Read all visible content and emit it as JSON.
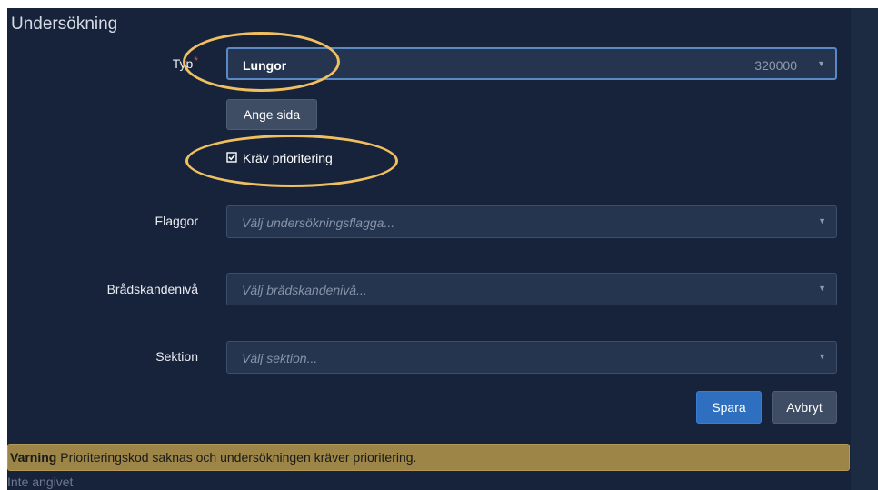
{
  "section_title": "Undersökning",
  "form": {
    "type": {
      "label": "Typ",
      "required_mark": "*",
      "value": "Lungor",
      "code": "320000"
    },
    "set_side_button": "Ange sida",
    "require_priority": {
      "label": "Kräv prioritering",
      "checked": true,
      "icon": "checkbox-checked-icon"
    },
    "flags": {
      "label": "Flaggor",
      "placeholder": "Välj undersökningsflagga..."
    },
    "urgency": {
      "label": "Brådskandenivå",
      "placeholder": "Välj brådskandenivå..."
    },
    "section": {
      "label": "Sektion",
      "placeholder": "Välj sektion..."
    },
    "save_button": "Spara",
    "cancel_button": "Avbryt",
    "caret_glyph": "▼"
  },
  "warning": {
    "title": "Varning",
    "message": "Prioriteringskod saknas och undersökningen kräver prioritering."
  },
  "footer_text": "Inte angivet",
  "colors": {
    "panel_bg": "#17233a",
    "field_bg": "#25344f",
    "accent_blue": "#2f6fbf",
    "warning_bg": "#9c8547",
    "highlight_ring": "#f0c060",
    "required_red": "#d9534f"
  }
}
